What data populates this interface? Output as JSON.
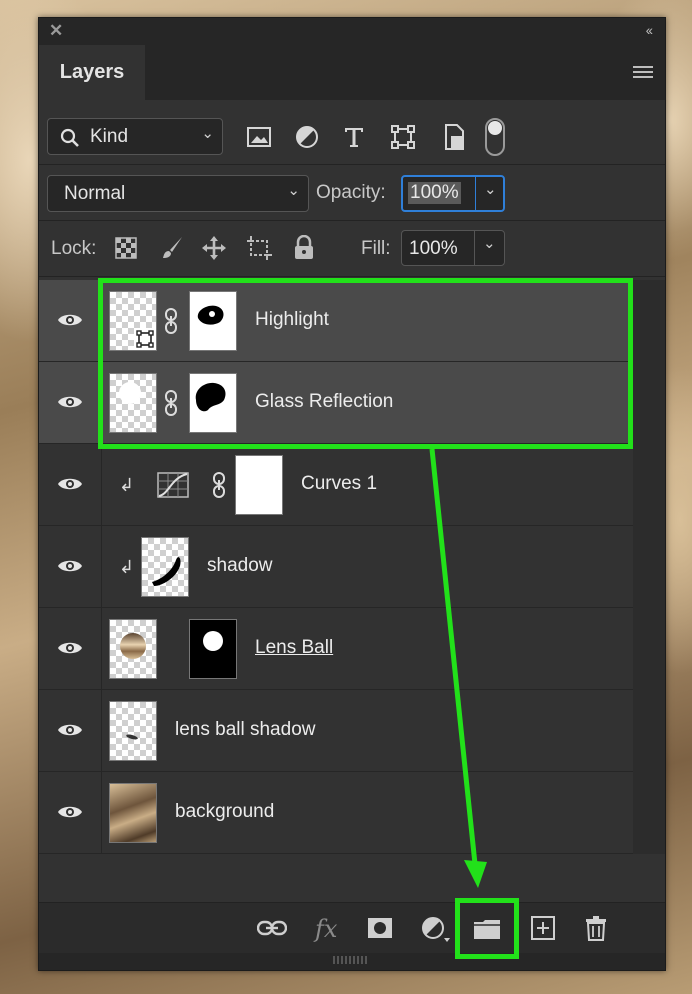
{
  "panel": {
    "title": "Layers"
  },
  "filter": {
    "kind_label": "Kind",
    "tool_icons": [
      "image-filter-icon",
      "adjustment-filter-icon",
      "type-filter-icon",
      "shape-filter-icon",
      "smart-object-filter-icon",
      "filter-toggle-switch"
    ]
  },
  "blend": {
    "mode": "Normal",
    "opacity_label": "Opacity:",
    "opacity_value": "100%"
  },
  "lock": {
    "label": "Lock:",
    "fill_label": "Fill:",
    "fill_value": "100%"
  },
  "layers": [
    {
      "name": "Highlight",
      "selected": true
    },
    {
      "name": "Glass Reflection",
      "selected": true
    },
    {
      "name": "Curves 1",
      "selected": false
    },
    {
      "name": "shadow",
      "selected": false
    },
    {
      "name": "Lens Ball",
      "selected": false
    },
    {
      "name": "lens ball shadow",
      "selected": false
    },
    {
      "name": "background",
      "selected": false
    }
  ],
  "footer": {
    "fx_label": "fx"
  },
  "colors": {
    "highlight_green": "#22e11a",
    "panel_bg": "#323232",
    "selected_row": "#4a4a4a"
  }
}
